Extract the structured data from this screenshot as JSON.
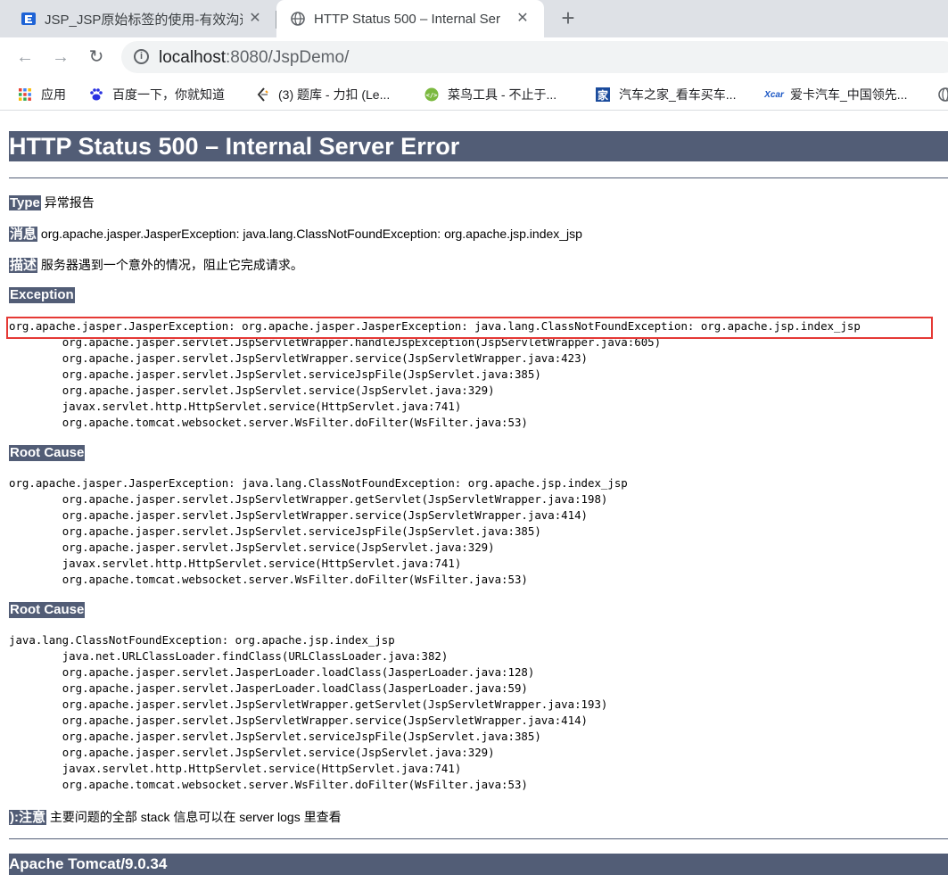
{
  "browser": {
    "tabs": [
      {
        "title": "JSP_JSP原始标签的使用-有效沟通",
        "active": false
      },
      {
        "title": "HTTP Status 500 – Internal Ser",
        "active": true
      }
    ],
    "new_tab_symbol": "+",
    "close_symbol": "✕",
    "nav": {
      "back": "←",
      "forward": "→",
      "reload": "↻"
    },
    "url_host": "localhost",
    "url_rest": ":8080/JspDemo/",
    "bookmarks": [
      {
        "label": "应用",
        "icon": "apps-grid-icon"
      },
      {
        "label": "百度一下，你就知道",
        "icon": "baidu-paw-icon"
      },
      {
        "label": "(3) 题库 - 力扣 (Le...",
        "icon": "leetcode-icon"
      },
      {
        "label": "菜鸟工具 - 不止于...",
        "icon": "runoob-icon"
      },
      {
        "label": "汽车之家_看车买车...",
        "icon": "autohome-icon"
      },
      {
        "label": "爱卡汽车_中国领先...",
        "icon": "xcar-icon"
      }
    ]
  },
  "page": {
    "heading": "HTTP Status 500 – Internal Server Error",
    "type_label": "Type",
    "type_value": "异常报告",
    "message_label": "消息",
    "message_value": "org.apache.jasper.JasperException: java.lang.ClassNotFoundException: org.apache.jsp.index_jsp",
    "description_label": "描述",
    "description_value": "服务器遇到一个意外的情况，阻止它完成请求。",
    "exception_label": "Exception",
    "exception_trace": "org.apache.jasper.JasperException: org.apache.jasper.JasperException: java.lang.ClassNotFoundException: org.apache.jsp.index_jsp\n\torg.apache.jasper.servlet.JspServletWrapper.handleJspException(JspServletWrapper.java:605)\n\torg.apache.jasper.servlet.JspServletWrapper.service(JspServletWrapper.java:423)\n\torg.apache.jasper.servlet.JspServlet.serviceJspFile(JspServlet.java:385)\n\torg.apache.jasper.servlet.JspServlet.service(JspServlet.java:329)\n\tjavax.servlet.http.HttpServlet.service(HttpServlet.java:741)\n\torg.apache.tomcat.websocket.server.WsFilter.doFilter(WsFilter.java:53)",
    "root_cause_label_1": "Root Cause",
    "root_cause_trace_1": "org.apache.jasper.JasperException: java.lang.ClassNotFoundException: org.apache.jsp.index_jsp\n\torg.apache.jasper.servlet.JspServletWrapper.getServlet(JspServletWrapper.java:198)\n\torg.apache.jasper.servlet.JspServletWrapper.service(JspServletWrapper.java:414)\n\torg.apache.jasper.servlet.JspServlet.serviceJspFile(JspServlet.java:385)\n\torg.apache.jasper.servlet.JspServlet.service(JspServlet.java:329)\n\tjavax.servlet.http.HttpServlet.service(HttpServlet.java:741)\n\torg.apache.tomcat.websocket.server.WsFilter.doFilter(WsFilter.java:53)",
    "root_cause_label_2": "Root Cause",
    "root_cause_trace_2": "java.lang.ClassNotFoundException: org.apache.jsp.index_jsp\n\tjava.net.URLClassLoader.findClass(URLClassLoader.java:382)\n\torg.apache.jasper.servlet.JasperLoader.loadClass(JasperLoader.java:128)\n\torg.apache.jasper.servlet.JasperLoader.loadClass(JasperLoader.java:59)\n\torg.apache.jasper.servlet.JspServletWrapper.getServlet(JspServletWrapper.java:193)\n\torg.apache.jasper.servlet.JspServletWrapper.service(JspServletWrapper.java:414)\n\torg.apache.jasper.servlet.JspServlet.serviceJspFile(JspServlet.java:385)\n\torg.apache.jasper.servlet.JspServlet.service(JspServlet.java:329)\n\tjavax.servlet.http.HttpServlet.service(HttpServlet.java:741)\n\torg.apache.tomcat.websocket.server.WsFilter.doFilter(WsFilter.java:53)",
    "note_label": "):注意",
    "note_value": "主要问题的全部 stack 信息可以在 server logs 里查看",
    "footer": "Apache Tomcat/9.0.34"
  },
  "colors": {
    "tomcat_header": "#525d76",
    "highlight_box": "#e53935",
    "tab_strip": "#dee1e6"
  }
}
